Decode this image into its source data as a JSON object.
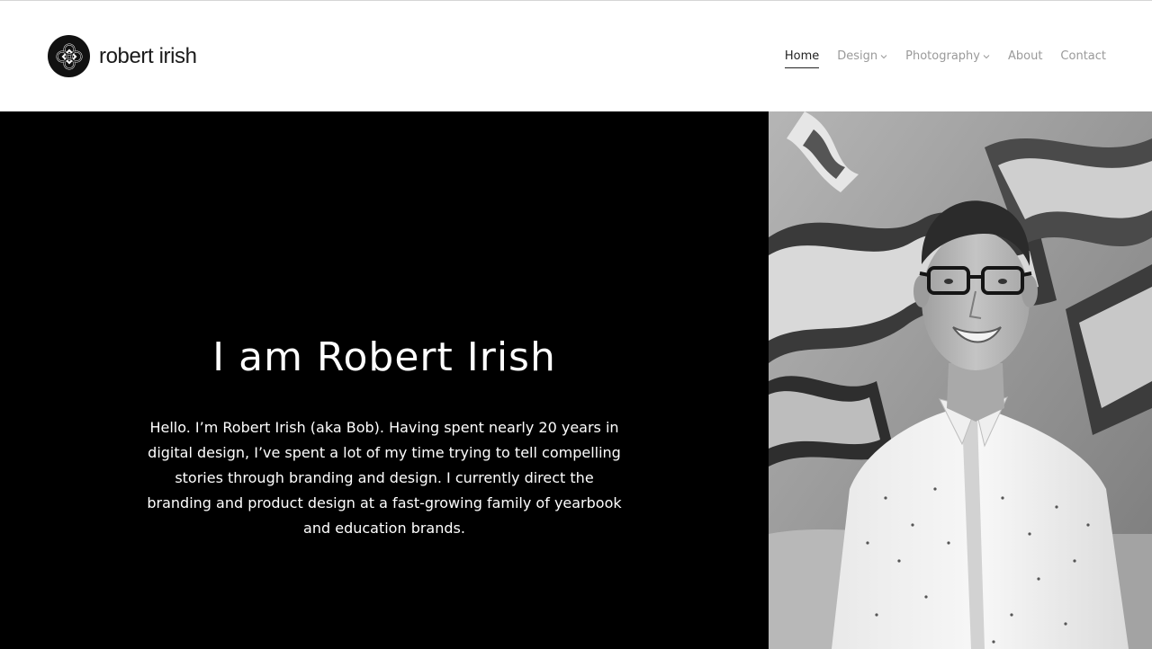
{
  "brand": {
    "name": "robert irish",
    "logo_icon": "celtic-knot-icon"
  },
  "nav": {
    "items": [
      {
        "label": "Home",
        "active": true,
        "has_dropdown": false
      },
      {
        "label": "Design",
        "active": false,
        "has_dropdown": true
      },
      {
        "label": "Photography",
        "active": false,
        "has_dropdown": true
      },
      {
        "label": "About",
        "active": false,
        "has_dropdown": false
      },
      {
        "label": "Contact",
        "active": false,
        "has_dropdown": false
      }
    ]
  },
  "hero": {
    "title": "I am Robert Irish",
    "intro": "Hello. I’m Robert Irish (aka Bob). Having spent nearly 20 years in digital design, I’ve spent a lot of my time trying to tell compelling stories through branding and design. I currently direct the branding and product design at a fast-growing family of yearbook and education brands.",
    "photo_icon": "portrait-photo"
  },
  "colors": {
    "hero_bg": "#000000",
    "header_bg": "#ffffff",
    "nav_active": "#222222",
    "nav_inactive": "#9a9a9a"
  }
}
